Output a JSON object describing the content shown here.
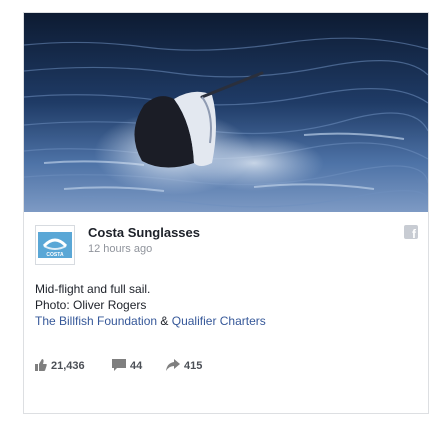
{
  "post": {
    "page_name": "Costa Sunglasses",
    "timestamp": "12 hours ago",
    "avatar_text": "COSTA",
    "facebook_icon": "f",
    "caption_line1": "Mid-flight and full sail.",
    "caption_line2": "Photo: Oliver Rogers",
    "tag1": "The Billfish Foundation",
    "tag_separator": " & ",
    "tag2": "Qualifier Charters"
  },
  "stats": {
    "likes": "21,436",
    "comments": "44",
    "shares": "415"
  },
  "icons": {
    "likes": "thumbs-up-icon",
    "comments": "comment-icon",
    "shares": "share-arrow-icon",
    "brand": "facebook-icon"
  },
  "colors": {
    "link": "#365899",
    "muted": "#90949c",
    "stat_text": "#4b4f56",
    "icon_gray": "#7f7f7f",
    "avatar_blue": "#5aa7d6"
  }
}
